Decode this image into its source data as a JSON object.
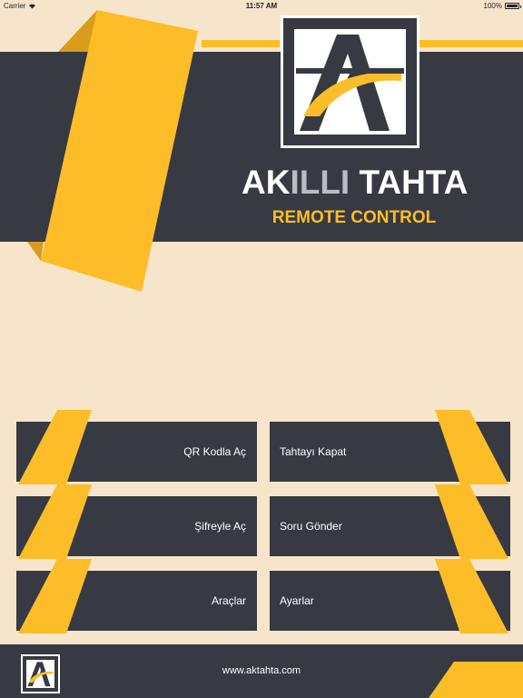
{
  "status_bar": {
    "carrier": "Carrier",
    "time": "11:57 AM",
    "battery": "100%"
  },
  "brand": {
    "title_part1": "AK",
    "title_part2": "ILLI",
    "title_part3": " TAHTA",
    "subtitle": "REMOTE CONTROL",
    "logo_icon": "akilli-tahta-logo"
  },
  "menu": {
    "items": [
      {
        "label": "QR Kodla Aç"
      },
      {
        "label": "Tahtayı Kapat"
      },
      {
        "label": "Şifreyle Aç"
      },
      {
        "label": "Soru Gönder"
      },
      {
        "label": "Araçlar"
      },
      {
        "label": "Ayarlar"
      }
    ]
  },
  "footer": {
    "url": "www.aktahta.com"
  },
  "colors": {
    "background": "#f7e5cb",
    "dark": "#373a42",
    "accent": "#fcbd28",
    "accent_shadow": "#d89d1c",
    "white": "#ffffff"
  }
}
